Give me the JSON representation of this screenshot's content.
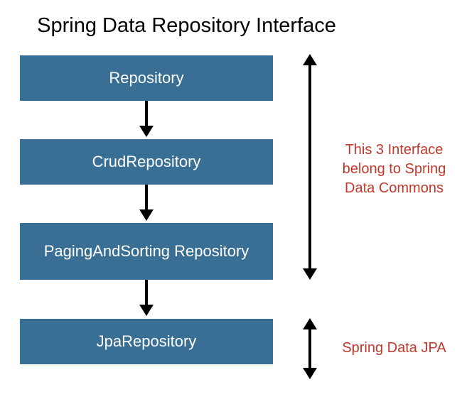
{
  "title": "Spring Data Repository Interface",
  "boxes": [
    {
      "label": "Repository"
    },
    {
      "label": "CrudRepository"
    },
    {
      "label": "PagingAndSorting Repository"
    },
    {
      "label": "JpaRepository"
    }
  ],
  "annotations": [
    {
      "text": "This 3 Interface belong to Spring Data Commons"
    },
    {
      "text": "Spring Data JPA"
    }
  ],
  "colors": {
    "box_bg": "#3a6f95",
    "box_text": "#ffffff",
    "annotation_text": "#c0392b"
  }
}
